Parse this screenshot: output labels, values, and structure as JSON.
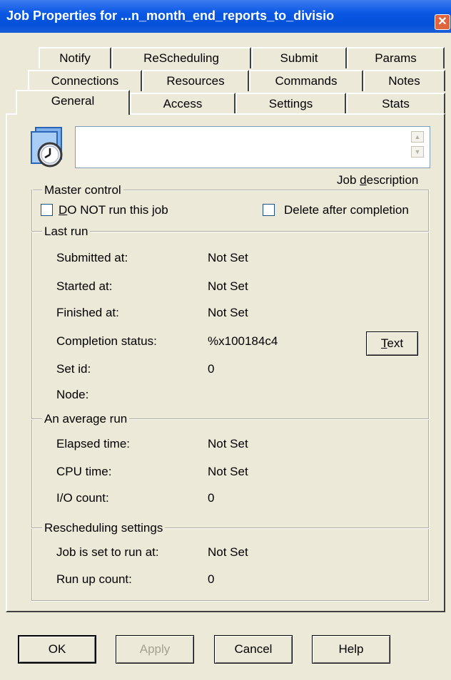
{
  "window": {
    "title": "Job Properties for ...n_month_end_reports_to_divisio",
    "close_glyph": "✕"
  },
  "tabs": {
    "row1": [
      "Notify",
      "ReScheduling",
      "Submit",
      "Params"
    ],
    "row2": [
      "Connections",
      "Resources",
      "Commands",
      "Notes"
    ],
    "row3": [
      "General",
      "Access",
      "Settings",
      "Stats"
    ],
    "active": "General"
  },
  "general": {
    "description_value": "",
    "description_label_pre": "Job ",
    "description_label_accel": "d",
    "description_label_post": "escription",
    "master_control": {
      "title": "Master control",
      "do_not_run_accel": "D",
      "do_not_run_rest": "O NOT run this job",
      "do_not_run_checked": false,
      "delete_after_label": "Delete after completion",
      "delete_after_checked": false
    },
    "last_run": {
      "title": "Last run",
      "rows": [
        {
          "label": "Submitted at:",
          "value": "Not Set"
        },
        {
          "label": "Started at:",
          "value": "Not Set"
        },
        {
          "label": "Finished at:",
          "value": "Not Set"
        },
        {
          "label": "Completion status:",
          "value": "%x100184c4"
        },
        {
          "label": "Set id:",
          "value": "0"
        },
        {
          "label": "Node:",
          "value": ""
        }
      ],
      "text_button_accel": "T",
      "text_button_rest": "ext"
    },
    "average_run": {
      "title": "An average run",
      "rows": [
        {
          "label": "Elapsed time:",
          "value": "Not Set"
        },
        {
          "label": "CPU time:",
          "value": "Not Set"
        },
        {
          "label": "I/O count:",
          "value": "0"
        }
      ]
    },
    "rescheduling": {
      "title": "Rescheduling settings",
      "rows": [
        {
          "label": "Job is set to run at:",
          "value": "Not Set"
        },
        {
          "label": "Run up count:",
          "value": "0"
        }
      ]
    }
  },
  "buttons": {
    "ok": "OK",
    "apply": "Apply",
    "cancel": "Cancel",
    "help": "Help"
  },
  "icons": {
    "job_icon": "job-document-clock-icon",
    "scroll_up": "scroll-up-arrow-icon",
    "scroll_down": "scroll-down-arrow-icon"
  },
  "colors": {
    "titlebar": "#0a58e4",
    "dialog_face": "#ece9d8",
    "close_button": "#e0653f"
  }
}
